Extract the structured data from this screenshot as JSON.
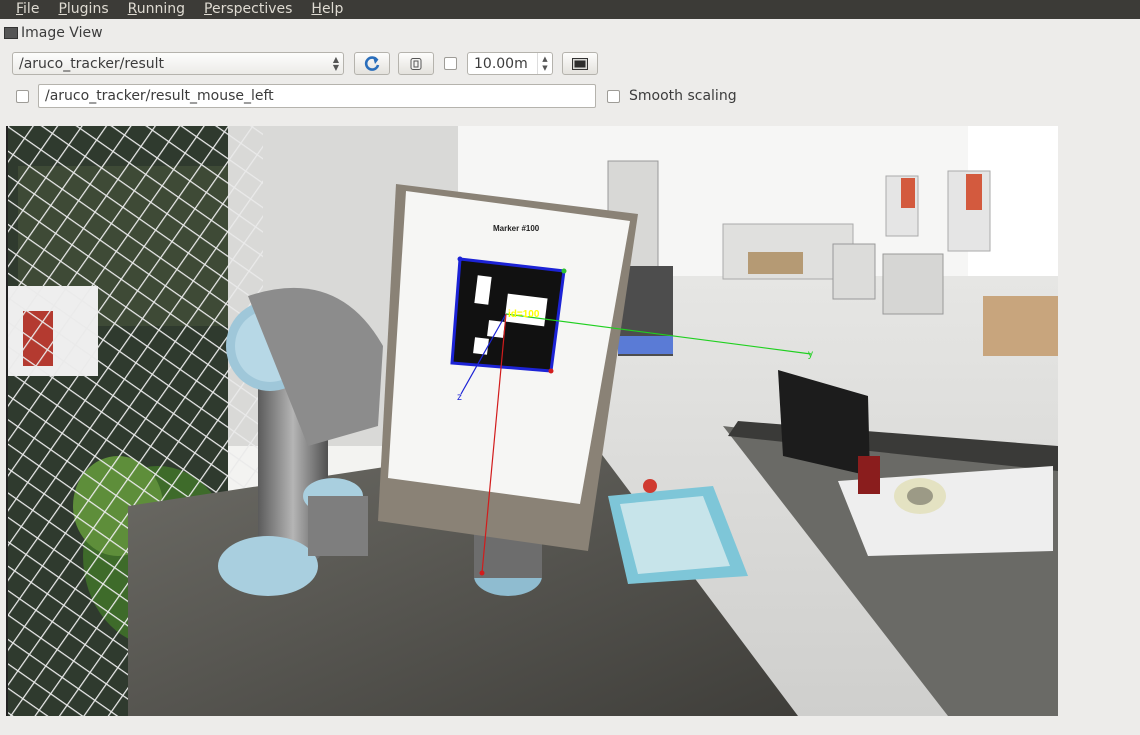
{
  "menubar": {
    "items": [
      {
        "label": "File"
      },
      {
        "label": "Plugins"
      },
      {
        "label": "Running"
      },
      {
        "label": "Perspectives"
      },
      {
        "label": "Help"
      }
    ]
  },
  "panel": {
    "title": "Image View"
  },
  "toolbar": {
    "topic": "/aruco_tracker/result",
    "refresh_icon": "refresh-icon",
    "zoom_fit_icon": "zoom-icon",
    "max_range": "10.00m",
    "save_icon": "save-icon"
  },
  "mouse_topic": {
    "value": "/aruco_tracker/result_mouse_left"
  },
  "smooth_scaling": {
    "label": "Smooth scaling",
    "checked": false
  },
  "image": {
    "sheet_header": "Marker #100",
    "marker_label": "id=100",
    "axis_y": "y",
    "axis_z": "z"
  }
}
